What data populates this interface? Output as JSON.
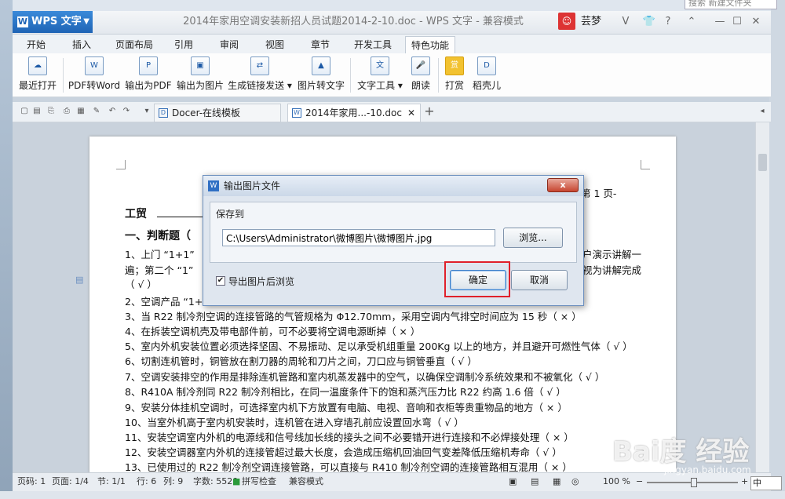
{
  "window": {
    "app_name": "WPS 文字",
    "title": "2014年家用空调安装新招人员试题2014-2-10.doc - WPS 文字 - 兼容模式",
    "desktop_search": "搜索 新建文件夹",
    "user": "芸梦",
    "help": "?"
  },
  "tabs": [
    "开始",
    "插入",
    "页面布局",
    "引用",
    "审阅",
    "视图",
    "章节",
    "开发工具",
    "特色功能"
  ],
  "ribbon": [
    "最近打开",
    "PDF转Word",
    "输出为PDF",
    "输出为图片",
    "生成链接发送",
    "图片转文字",
    "文字工具",
    "朗读",
    "打赏",
    "稻壳儿"
  ],
  "ribbon_icons": [
    "cloud-icon",
    "pdf-to-word-icon",
    "pdf-export-icon",
    "image-export-icon",
    "link-send-icon",
    "image-to-text-icon",
    "text-tools-icon",
    "read-aloud-icon",
    "reward-icon",
    "docer-icon"
  ],
  "doc_tabs": [
    "Docer-在线模板",
    "2014年家用...-10.doc"
  ],
  "document": {
    "page_label": "第 1 页-",
    "header_left": "工贸",
    "section": "一、判断题（",
    "lines": [
      "1、上门 “1+1”",
      "遍；第二个 “1”",
      "（    √  ）",
      "2、空调产品 “1+",
      "3、当 R22 制冷剂空调的连接管路的气管规格为 Φ12.70mm，采用空调内气排空时间应为 15 秒（    ×    ）",
      "4、在拆装空调机壳及带电部件前，可不必要将空调电源断掉（    ×    ）",
      "5、室内外机安装位置必须选择坚固、不易振动、足以承受机组重量 200Kg 以上的地方，并且避开可燃性气体（    √  ）",
      "6、切割连机管时，铜管放在割刀器的周轮和刀片之间，刀口应与铜管垂直（    √    ）",
      "7、空调安装排空的作用是排除连机管路和室内机蒸发器中的空气，以确保空调制冷系统效果和不被氧化（    √  ）",
      "8、R410A 制冷剂同 R22 制冷剂相比，在同一温度条件下的饱和蒸汽压力比 R22 约高 1.6 倍（      √    ）",
      "9、安装分体挂机空调时，可选择室内机下方放置有电脑、电视、音响和衣柜等贵重物品的地方（    ×    ）",
      "10、当室外机高于室内机安装时，连机管在进入穿墙孔前应设置回水弯（    √    ）",
      "11、安装空调室内外机的电源线和信号线加长线的接头之间不必要错开进行连接和不必焊接处理（    ×    ）",
      "12、安装空调器室内外机的连接管超过最大长度，会造成压缩机回油回气变差降低压缩机寿命（    √    ）",
      "13、已使用过的 R22 制冷剂空调连接管路，可以直接与 R410 制冷剂空调的连接管路相互混用（    ×    ）"
    ],
    "right_fragments": [
      "户演示讲解一",
      "视为讲解完成"
    ]
  },
  "dialog": {
    "title": "输出图片文件",
    "close": "x",
    "group_label": "保存到",
    "path": "C:\\Users\\Administrator\\微博图片\\微博图片.jpg",
    "browse": "浏览...",
    "checkbox_label": "导出图片后浏览",
    "checked": true,
    "ok": "确定",
    "cancel": "取消"
  },
  "status": {
    "page": "页码: 1",
    "pages": "页面: 1/4",
    "section": "节: 1/1",
    "row": "行: 6",
    "col": "列: 9",
    "words": "字数: 5520",
    "spell": "拼写检查",
    "compat": "兼容模式",
    "zoom": "100 %"
  },
  "watermark": {
    "brand": "Bai度 经验",
    "url": "jingyan.baidu.com"
  },
  "ime": "中"
}
